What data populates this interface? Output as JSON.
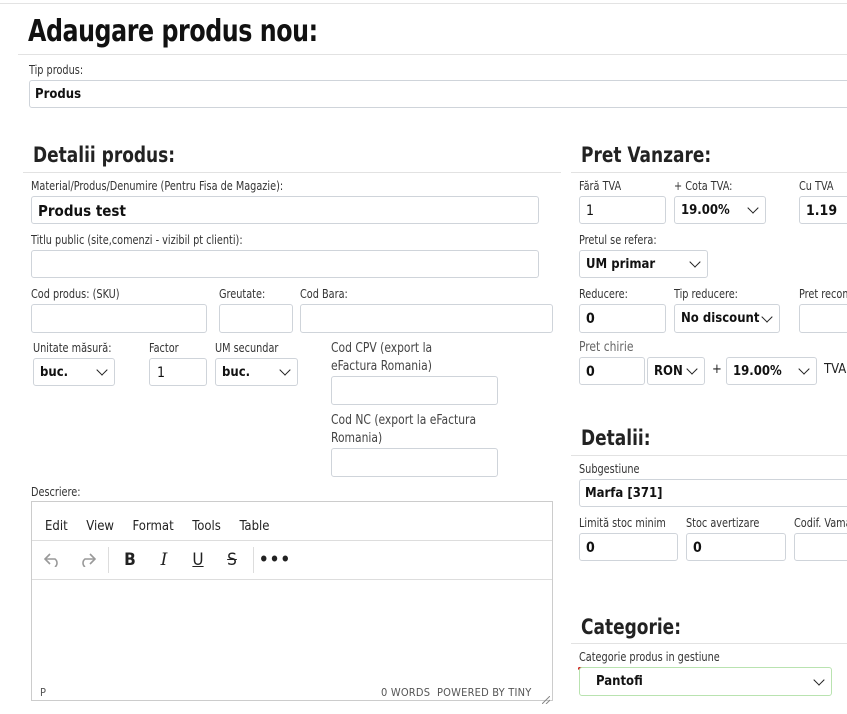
{
  "page": {
    "title": "Adaugare produs nou:"
  },
  "tip_produs": {
    "label": "Tip produs:",
    "value": "Produs"
  },
  "detalii_produs": {
    "title": "Detalii produs:",
    "material_label": "Material/Produs/Denumire (Pentru Fisa de Magazie):",
    "material_value": "Produs test",
    "titlu_public_label": "Titlu public (site,comenzi - vizibil pt clienti):",
    "titlu_public_value": "",
    "cod_produs_label": "Cod produs: (SKU)",
    "greutate_label": "Greutate:",
    "cod_bara_label": "Cod Bara:",
    "unitate_label": "Unitate măsură:",
    "unitate_value": "buc.",
    "factor_label": "Factor",
    "factor_value": "1",
    "um_secundar_label": "UM secundar",
    "um_secundar_value": "buc.",
    "cod_cpv_label_1": "Cod CPV (export la",
    "cod_cpv_label_2": "eFactura Romania)",
    "cod_nc_label_1": "Cod NC (export la eFactura",
    "cod_nc_label_2": "Romania)",
    "descriere_label": "Descriere:"
  },
  "editor": {
    "menu": [
      "Edit",
      "View",
      "Format",
      "Tools",
      "Table"
    ],
    "status_path": "P",
    "word_count": "0 WORDS",
    "powered_by": "POWERED BY TINY"
  },
  "pret_vanzare": {
    "title": "Pret Vanzare:",
    "fara_tva_label": "Fără TVA",
    "fara_tva_value": "1",
    "cota_tva_label": "+ Cota TVA:",
    "cota_tva_value": "19.00%",
    "cu_tva_label": "Cu TVA",
    "cu_tva_value": "1.19",
    "pret_refera_label": "Pretul se refera:",
    "pret_refera_value": "UM primar",
    "reducere_label": "Reducere:",
    "reducere_value": "0",
    "tip_reducere_label": "Tip reducere:",
    "tip_reducere_value": "No discount",
    "pret_recom_label": "Pret recom",
    "pret_chirie_label": "Pret chirie",
    "pret_chirie_value": "0",
    "moneda_value": "RON",
    "plus": "+",
    "chirie_tva_value": "19.00%",
    "tva_label": "TVA"
  },
  "detalii": {
    "title": "Detalii:",
    "subgestiune_label": "Subgestiune",
    "subgestiune_value": "Marfa [371]",
    "limita_label": "Limită stoc minim",
    "limita_value": "0",
    "stoc_avert_label": "Stoc avertizare",
    "stoc_avert_value": "0",
    "codif_label": "Codif. Vama"
  },
  "categorie": {
    "title": "Categorie:",
    "label": "Categorie produs in gestiune",
    "value": "Pantofi"
  },
  "colors": {
    "underline": "#d01c1c",
    "focus_green": "#b9e3b0"
  }
}
